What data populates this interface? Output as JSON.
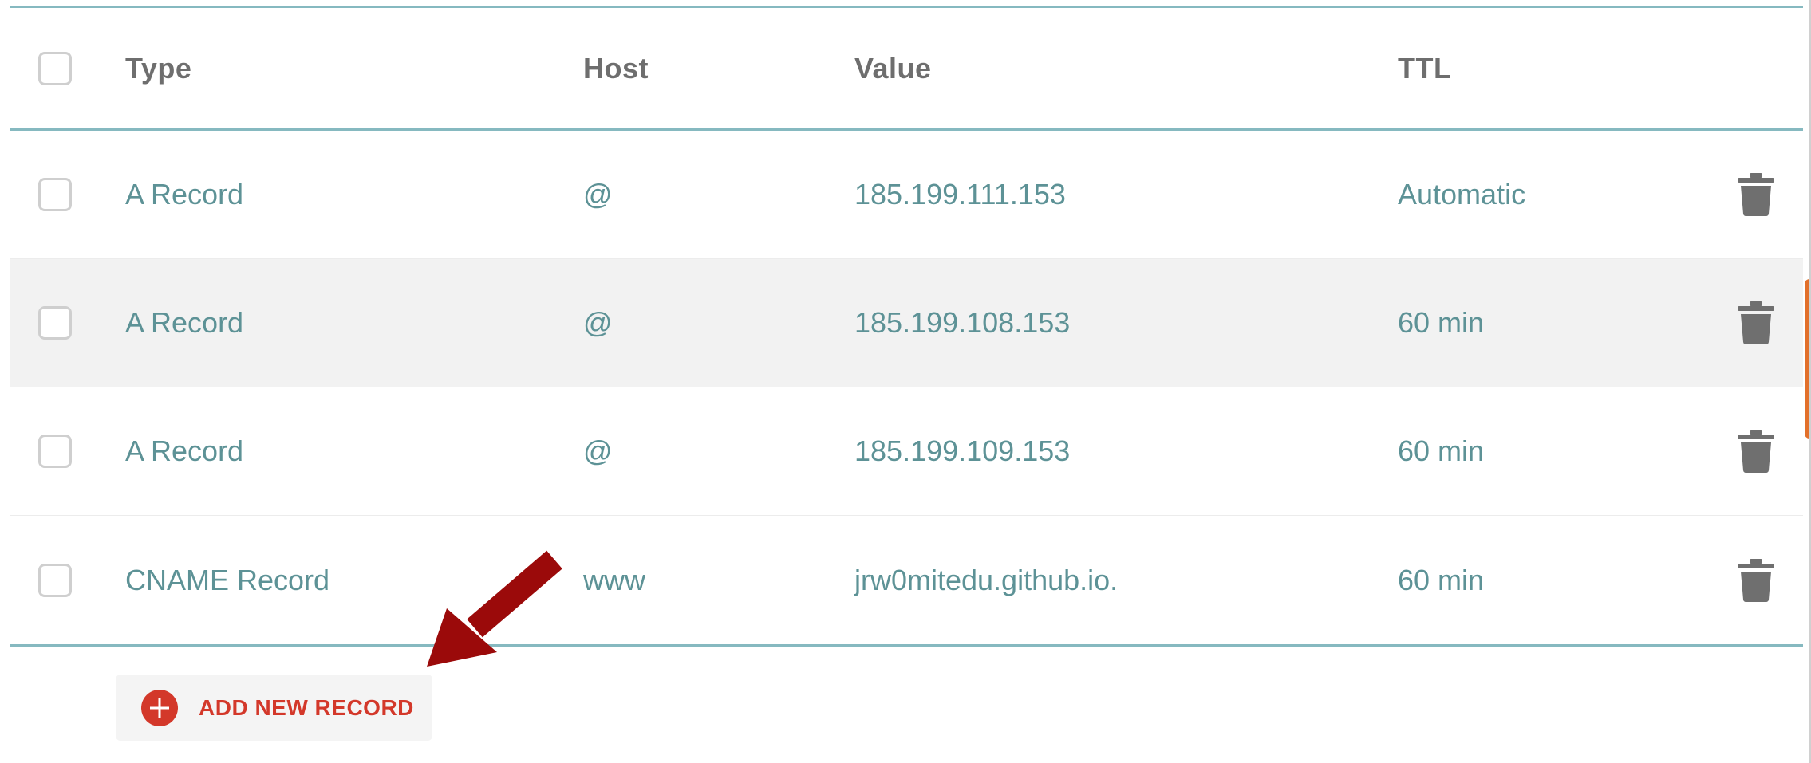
{
  "table": {
    "headers": {
      "type": "Type",
      "host": "Host",
      "value": "Value",
      "ttl": "TTL"
    },
    "rows": [
      {
        "type": "A Record",
        "host": "@",
        "value": "185.199.111.153",
        "ttl": "Automatic"
      },
      {
        "type": "A Record",
        "host": "@",
        "value": "185.199.108.153",
        "ttl": "60 min"
      },
      {
        "type": "A Record",
        "host": "@",
        "value": "185.199.109.153",
        "ttl": "60 min"
      },
      {
        "type": "CNAME Record",
        "host": "www",
        "value": "jrw0mitedu.github.io.",
        "ttl": "60 min"
      }
    ]
  },
  "actions": {
    "add_record_label": "ADD NEW RECORD"
  },
  "icons": {
    "delete": "trash-icon",
    "add": "plus-circle-icon",
    "annotation": "arrow-annotation"
  },
  "colors": {
    "accent_line": "#86b9c0",
    "value_text": "#5d9296",
    "header_text": "#6e6e6e",
    "add_button_text": "#d3382a",
    "arrow": "#9b0a0a",
    "trash": "#6f6f6f"
  }
}
